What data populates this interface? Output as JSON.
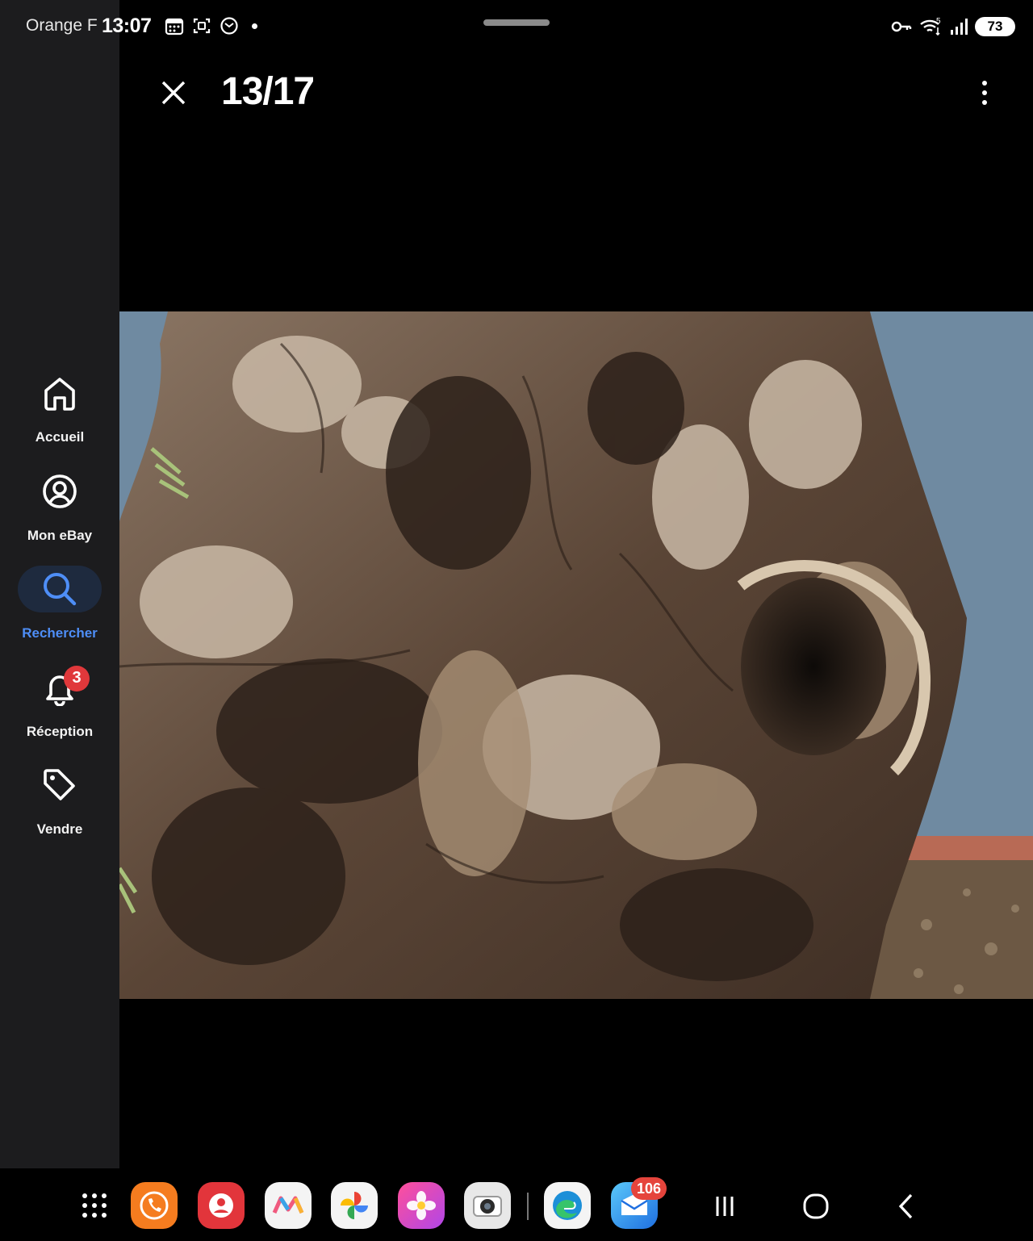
{
  "status_bar": {
    "carrier": "Orange F",
    "time": "13:07",
    "battery": "73",
    "signal_label": "5"
  },
  "viewer": {
    "counter": "13/17"
  },
  "sidebar": {
    "items": [
      {
        "label": "Accueil",
        "icon": "home-icon"
      },
      {
        "label": "Mon eBay",
        "icon": "account-icon"
      },
      {
        "label": "Rechercher",
        "icon": "search-icon",
        "active": true
      },
      {
        "label": "Réception",
        "icon": "bell-icon",
        "badge": "3"
      },
      {
        "label": "Vendre",
        "icon": "tag-icon"
      }
    ],
    "accent_color": "#4e8ef7",
    "badge_color": "#e0383b"
  },
  "dock": {
    "apps": [
      "app-drawer-icon",
      "phone-app-icon",
      "contacts-app-icon",
      "gallery-app-icon",
      "photos-app-icon",
      "blossom-app-icon",
      "camera-app-icon",
      "edge-browser-icon",
      "email-app-icon"
    ],
    "email_badge": "106"
  }
}
